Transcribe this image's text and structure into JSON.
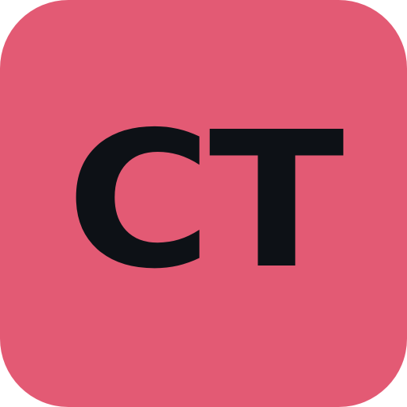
{
  "icon": {
    "monogram": "CT",
    "background_color": "#e35a74",
    "text_color": "#0d1116"
  }
}
